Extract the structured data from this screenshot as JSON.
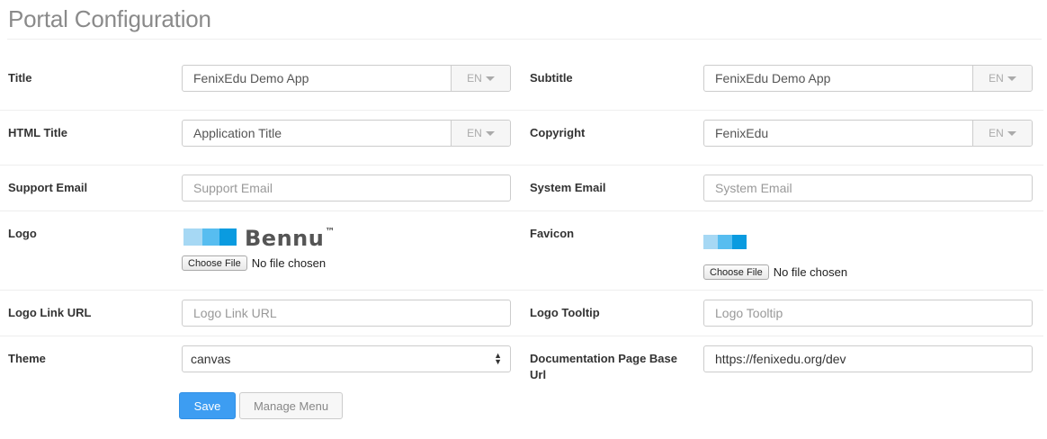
{
  "page": {
    "title": "Portal Configuration"
  },
  "fields": {
    "title": {
      "label": "Title",
      "value": "FenixEdu Demo App",
      "lang": "EN"
    },
    "subtitle": {
      "label": "Subtitle",
      "value": "FenixEdu Demo App",
      "lang": "EN"
    },
    "html_title": {
      "label": "HTML Title",
      "value": "Application Title",
      "lang": "EN"
    },
    "copyright": {
      "label": "Copyright",
      "value": "FenixEdu",
      "lang": "EN"
    },
    "support_email": {
      "label": "Support Email",
      "placeholder": "Support Email"
    },
    "system_email": {
      "label": "System Email",
      "placeholder": "System Email"
    },
    "logo": {
      "label": "Logo",
      "brand_text": "Bennu",
      "trademark": "™",
      "choose_label": "Choose File",
      "status": "No file chosen"
    },
    "favicon": {
      "label": "Favicon",
      "choose_label": "Choose File",
      "status": "No file chosen"
    },
    "logo_link_url": {
      "label": "Logo Link URL",
      "placeholder": "Logo Link URL"
    },
    "logo_tooltip": {
      "label": "Logo Tooltip",
      "placeholder": "Logo Tooltip"
    },
    "theme": {
      "label": "Theme",
      "value": "canvas"
    },
    "doc_base_url": {
      "label_line1": "Documentation Page Base",
      "label_line2": "Url",
      "value": "https://fenixedu.org/dev"
    }
  },
  "actions": {
    "save": "Save",
    "manage_menu": "Manage Menu"
  },
  "colors": {
    "primary": "#3d9df2",
    "logo_light": "#a6d8f4",
    "logo_mid": "#57bdf0",
    "logo_dark": "#0a9be0"
  }
}
